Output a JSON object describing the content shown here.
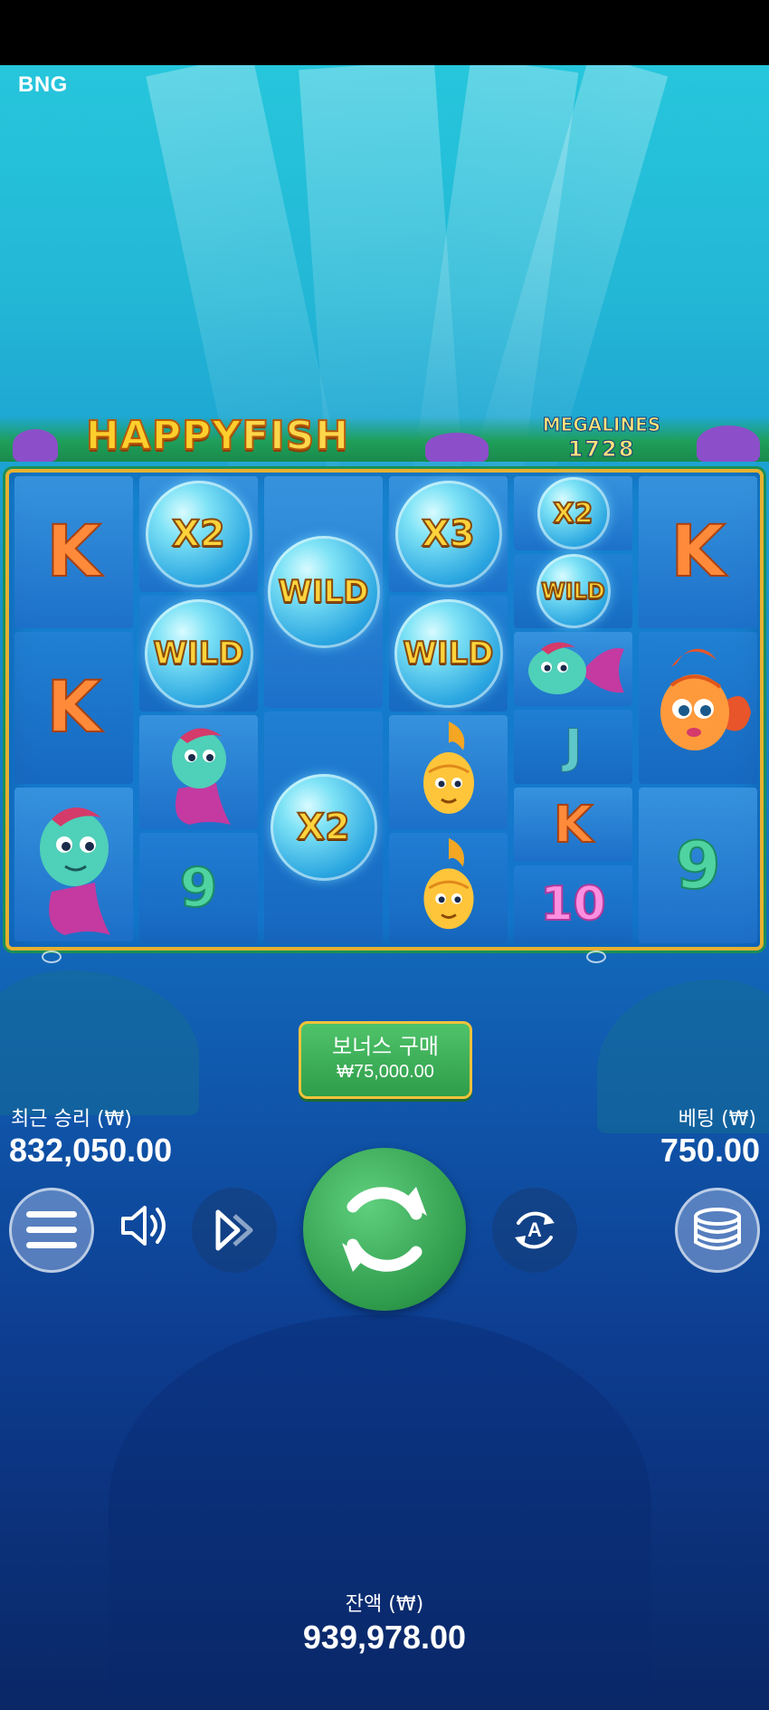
{
  "app": {
    "brand": "BNG"
  },
  "game": {
    "logo": {
      "word1": "HAPPY",
      "word2": "FISH"
    },
    "megalines": {
      "label": "MEGALINES",
      "count": "1728"
    }
  },
  "reels": [
    {
      "symbols": [
        "K",
        "K",
        "fish-teal"
      ]
    },
    {
      "symbols": [
        "X2",
        "WILD",
        "fish-teal",
        "9"
      ]
    },
    {
      "symbols": [
        "WILD",
        "X2"
      ]
    },
    {
      "symbols": [
        "X3",
        "WILD",
        "fish-gold",
        "fish-gold"
      ]
    },
    {
      "symbols": [
        "X2",
        "WILD",
        "fish-teal",
        "J",
        "K",
        "10"
      ]
    },
    {
      "symbols": [
        "K",
        "fish-orange",
        "9"
      ]
    }
  ],
  "bonus": {
    "title": "보너스 구매",
    "price": "₩75,000.00"
  },
  "last_win": {
    "label": "최근 승리 (₩)",
    "value": "832,050.00"
  },
  "bet": {
    "label": "베팅 (₩)",
    "value": "750.00"
  },
  "balance": {
    "label": "잔액 (₩)",
    "value": "939,978.00"
  },
  "controls": {
    "menu_icon": "hamburger-icon",
    "sound_icon": "speaker-icon",
    "turbo_icon": "fast-forward-icon",
    "spin_icon": "spin-arrows-icon",
    "autoplay_icon": "autoplay-icon",
    "autoplay_letter": "A",
    "bet_icon": "coins-stack-icon"
  },
  "colors": {
    "frame_gold": "#e6b130",
    "spin_green": "#2e9a4b",
    "k_orange": "#ff8a3a",
    "nine_green": "#4fd3a0",
    "ten_pink": "#ff8fe0"
  }
}
